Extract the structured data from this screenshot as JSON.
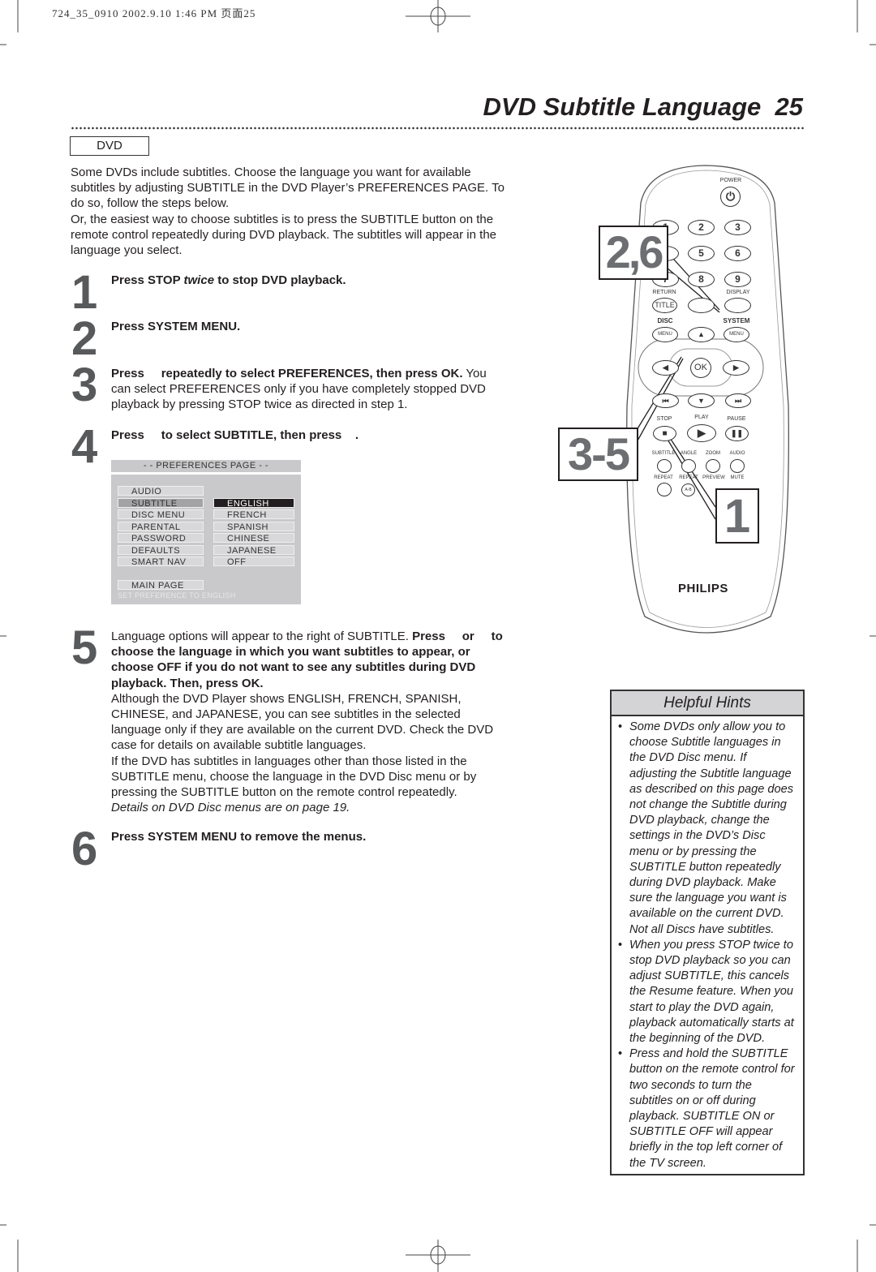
{
  "slug": "724_35_0910  2002.9.10 1:46 PM 页面25",
  "header": {
    "title": "DVD Subtitle Language",
    "page_number": "25"
  },
  "tag": "DVD",
  "intro": {
    "p1": "Some DVDs include subtitles. Choose the language you want for available subtitles by adjusting SUBTITLE in the DVD Player’s PREFERENCES PAGE. To do so, follow the steps below.",
    "p2": "Or, the easiest way to choose subtitles is to press the SUBTITLE button on the remote control repeatedly during DVD playback. The subtitles will appear in the language you select."
  },
  "steps": [
    {
      "num": "1",
      "a": "Press STOP ",
      "b": "twice",
      "c": " to stop DVD playback."
    },
    {
      "num": "2",
      "a": "Press SYSTEM MENU."
    },
    {
      "num": "3",
      "a": "Press     repeatedly to select PREFERENCES, then press OK.",
      "b": " You can select PREFERENCES only if you have completely stopped DVD playback by pressing STOP twice as directed in step 1."
    },
    {
      "num": "4",
      "a": "Press     to select SUBTITLE, then press    ."
    },
    {
      "num": "5",
      "a": "Language options will appear to the right of SUBTITLE. ",
      "b": "Press     or     to choose the language in which you want subtitles to appear, or choose OFF if you do not want to see any subtitles during DVD playback. Then, press OK.",
      "c": "Although the DVD Player shows ENGLISH, FRENCH, SPANISH, CHINESE, and JAPANESE, you can see subtitles in the selected language only if they are available on the current DVD. Check the DVD case for details on available subtitle languages.",
      "d": "If the DVD has subtitles in languages other than those listed in the SUBTITLE menu, choose the language in the DVD Disc menu or by pressing the SUBTITLE button on the remote control repeatedly.",
      "e": "Details on DVD Disc menus are on page 19."
    },
    {
      "num": "6",
      "a": "Press SYSTEM MENU to remove the menus."
    }
  ],
  "menu": {
    "title": "- -  PREFERENCES PAGE  - -",
    "items": [
      "AUDIO",
      "SUBTITLE",
      "DISC MENU",
      "PARENTAL",
      "PASSWORD",
      "DEFAULTS",
      "SMART NAV"
    ],
    "selected_item": "SUBTITLE",
    "options": [
      "ENGLISH",
      "FRENCH",
      "SPANISH",
      "CHINESE",
      "JAPANESE",
      "OFF"
    ],
    "selected_option": "ENGLISH",
    "main_page": "MAIN PAGE",
    "footer": "SET PREFERENCE TO ENGLISH"
  },
  "remote": {
    "power": "POWER",
    "digits": [
      "1",
      "2",
      "3",
      "4",
      "5",
      "6",
      "7",
      "8",
      "9"
    ],
    "return": "RETURN",
    "display": "DISPLAY",
    "title": "TITLE",
    "disc": "DISC",
    "system": "SYSTEM",
    "menu": "MENU",
    "ok": "OK",
    "stop": "STOP",
    "play": "PLAY",
    "pause": "PAUSE",
    "subtitle": "SUBTITLE",
    "angle": "ANGLE",
    "zoom": "ZOOM",
    "audio": "AUDIO",
    "repeat": "REPEAT",
    "repeat_ab": "REPEAT",
    "preview": "PREVIEW",
    "mute": "MUTE",
    "ab": "A-B",
    "brand": "PHILIPS",
    "callouts": [
      "2,6",
      "3-5",
      "1"
    ]
  },
  "hints": {
    "title": "Helpful Hints",
    "items": [
      "Some DVDs only allow you to choose Subtitle languages in the DVD Disc menu. If adjusting the Subtitle language as described on this page does not change the Subtitle during DVD playback, change the settings in the DVD’s Disc menu or by pressing the SUBTITLE button repeatedly during DVD playback. Make sure the language you want is available on the current DVD. Not all Discs have subtitles.",
      "When you press STOP twice to stop DVD playback so you can adjust SUBTITLE, this cancels the Resume feature. When you start to play the DVD again, playback automatically starts at the beginning of the DVD.",
      "Press and hold the SUBTITLE button on the remote control for two seconds to turn the subtitles on or off during playback. SUBTITLE ON or SUBTITLE OFF will appear briefly in the top left corner of the TV screen."
    ]
  }
}
